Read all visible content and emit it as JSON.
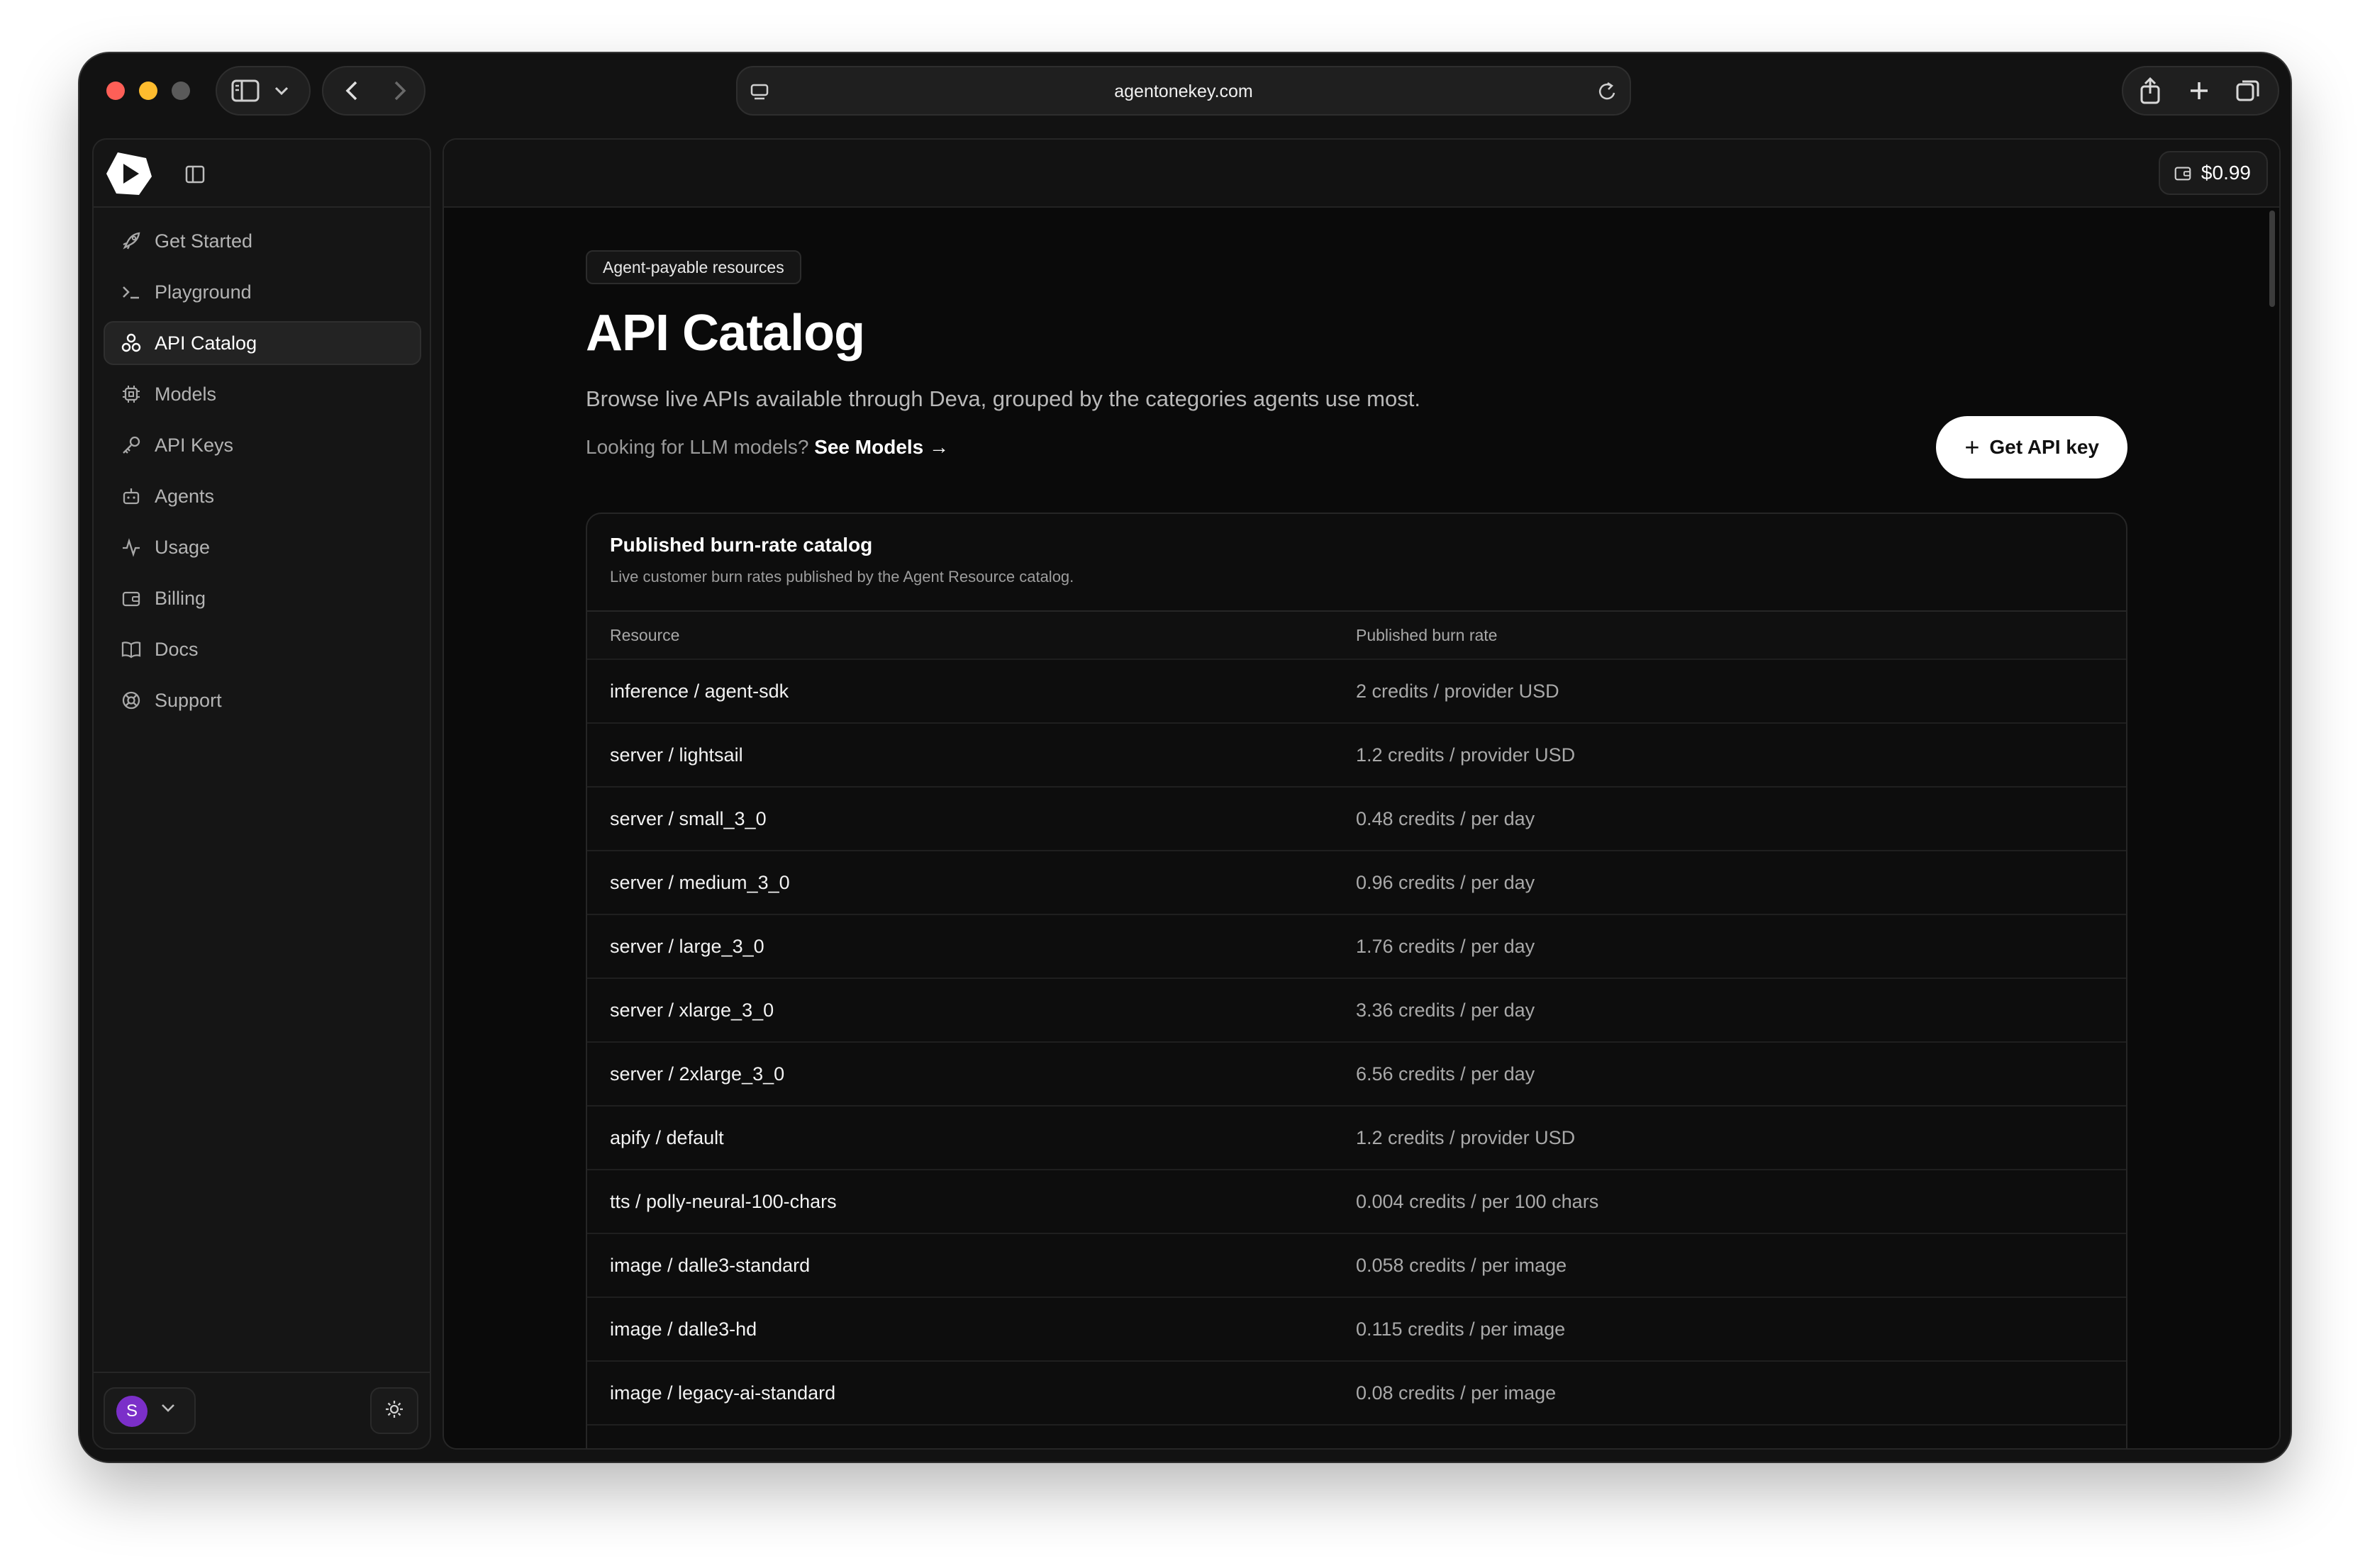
{
  "browser": {
    "url": "agentonekey.com"
  },
  "sidebar": {
    "items": [
      {
        "label": "Get Started",
        "icon": "rocket-icon",
        "active": false
      },
      {
        "label": "Playground",
        "icon": "terminal-icon",
        "active": false
      },
      {
        "label": "API Catalog",
        "icon": "network-icon",
        "active": true
      },
      {
        "label": "Models",
        "icon": "chip-icon",
        "active": false
      },
      {
        "label": "API Keys",
        "icon": "key-icon",
        "active": false
      },
      {
        "label": "Agents",
        "icon": "bot-icon",
        "active": false
      },
      {
        "label": "Usage",
        "icon": "activity-icon",
        "active": false
      },
      {
        "label": "Billing",
        "icon": "wallet-icon",
        "active": false
      },
      {
        "label": "Docs",
        "icon": "book-icon",
        "active": false
      },
      {
        "label": "Support",
        "icon": "lifebuoy-icon",
        "active": false
      }
    ],
    "user_initial": "S"
  },
  "header": {
    "balance": "$0.99"
  },
  "page": {
    "eyebrow": "Agent-payable resources",
    "title": "API Catalog",
    "subtitle": "Browse live APIs available through Deva, grouped by the categories agents use most.",
    "models_prompt": "Looking for LLM models?",
    "models_link": "See Models →",
    "api_button": "Get API key"
  },
  "catalog": {
    "title": "Published burn-rate catalog",
    "subtitle": "Live customer burn rates published by the Agent Resource catalog.",
    "columns": [
      "Resource",
      "Published burn rate"
    ],
    "rows": [
      {
        "resource": "inference / agent-sdk",
        "rate": "2 credits / provider USD"
      },
      {
        "resource": "server / lightsail",
        "rate": "1.2 credits / provider USD"
      },
      {
        "resource": "server / small_3_0",
        "rate": "0.48 credits / per day"
      },
      {
        "resource": "server / medium_3_0",
        "rate": "0.96 credits / per day"
      },
      {
        "resource": "server / large_3_0",
        "rate": "1.76 credits / per day"
      },
      {
        "resource": "server / xlarge_3_0",
        "rate": "3.36 credits / per day"
      },
      {
        "resource": "server / 2xlarge_3_0",
        "rate": "6.56 credits / per day"
      },
      {
        "resource": "apify / default",
        "rate": "1.2 credits / provider USD"
      },
      {
        "resource": "tts / polly-neural-100-chars",
        "rate": "0.004 credits / per 100 chars"
      },
      {
        "resource": "image / dalle3-standard",
        "rate": "0.058 credits / per image"
      },
      {
        "resource": "image / dalle3-hd",
        "rate": "0.115 credits / per image"
      },
      {
        "resource": "image / legacy-ai-standard",
        "rate": "0.08 credits / per image"
      }
    ]
  }
}
